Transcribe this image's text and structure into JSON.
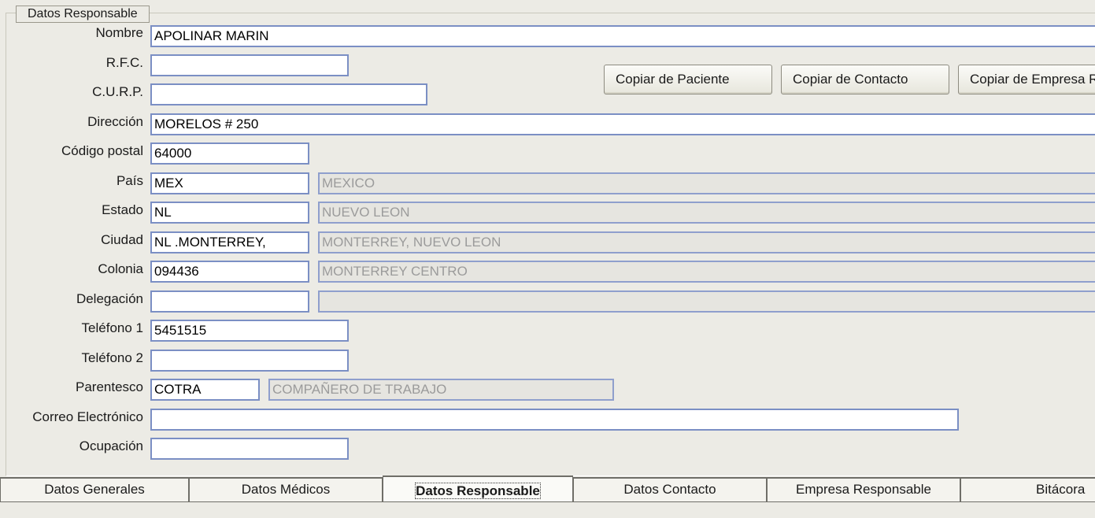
{
  "group": {
    "title": "Datos Responsable"
  },
  "form": {
    "nombre": {
      "label": "Nombre",
      "value": "APOLINAR MARIN"
    },
    "rfc": {
      "label": "R.F.C.",
      "value": ""
    },
    "curp": {
      "label": "C.U.R.P.",
      "value": ""
    },
    "direccion": {
      "label": "Dirección",
      "value": "MORELOS # 250"
    },
    "codigo_postal": {
      "label": "Código postal",
      "value": "64000"
    },
    "pais": {
      "label": "País",
      "code": "MEX",
      "description": "MEXICO"
    },
    "estado": {
      "label": "Estado",
      "code": "NL",
      "description": "NUEVO LEON"
    },
    "ciudad": {
      "label": "Ciudad",
      "code": "NL .MONTERREY,",
      "description": "MONTERREY, NUEVO LEON"
    },
    "colonia": {
      "label": "Colonia",
      "code": "094436",
      "description": "MONTERREY CENTRO"
    },
    "delegacion": {
      "label": "Delegación",
      "code": "",
      "description": ""
    },
    "telefono1": {
      "label": "Teléfono 1",
      "value": "5451515"
    },
    "telefono2": {
      "label": "Teléfono 2",
      "value": ""
    },
    "parentesco": {
      "label": "Parentesco",
      "code": "COTRA",
      "description": "COMPAÑERO DE TRABAJO"
    },
    "correo": {
      "label": "Correo Electrónico",
      "value": ""
    },
    "ocupacion": {
      "label": "Ocupación",
      "value": ""
    }
  },
  "buttons": {
    "copiar_paciente": "Copiar de Paciente",
    "copiar_contacto": "Copiar de Contacto",
    "copiar_empresa": "Copiar de Empresa Re"
  },
  "tabs": [
    {
      "label": "Datos Generales",
      "active": false
    },
    {
      "label": "Datos Médicos",
      "active": false
    },
    {
      "label": "Datos Responsable",
      "active": true
    },
    {
      "label": "Datos Contacto",
      "active": false
    },
    {
      "label": "Empresa Responsable",
      "active": false
    },
    {
      "label": "Bitácora",
      "active": false
    }
  ],
  "colors": {
    "field_border": "#7b8fc4",
    "window_background": "#ecebe5",
    "readonly_background": "#e6e5e0"
  }
}
